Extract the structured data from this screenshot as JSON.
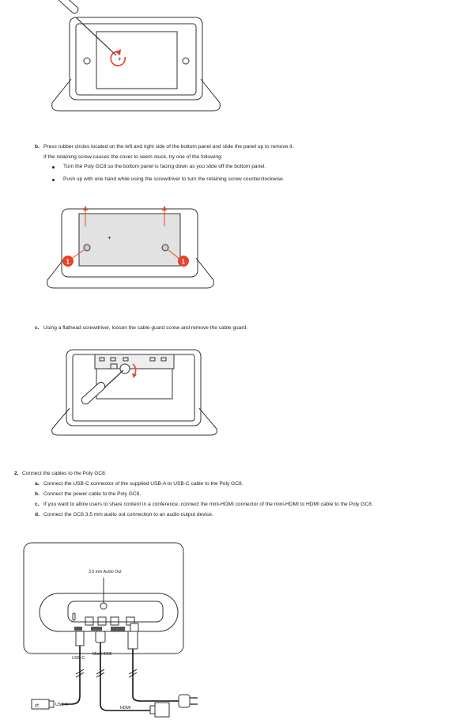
{
  "step_b": {
    "label": "b.",
    "text": "Press rubber circles located on the left and right side of the bottom panel and slide the panel up to remove it.",
    "note": "If the retaining screw causes the cover to seem stuck, try one of the following:",
    "bullets": [
      "Turn the Poly GC8 so the bottom panel is facing down as you slide off the bottom panel.",
      "Push up with one hand while using the screwdriver to turn the retaining screw counterclockwise."
    ]
  },
  "callouts": [
    "1",
    "1"
  ],
  "step_c": {
    "label": "c.",
    "text": "Using a flathead screwdriver, loosen the cable guard screw and remove the cable guard."
  },
  "step_2": {
    "label": "2.",
    "text": "Connect the cables to the Poly GC8.",
    "substeps": [
      {
        "label": "a.",
        "text": "Connect the USB-C connector of the supplied USB-A to USB-C cable to the Poly GC8."
      },
      {
        "label": "b.",
        "text": "Connect the power cable to the Poly GC8."
      },
      {
        "label": "c.",
        "text": "If you want to allow users to share content in a conference, connect the mini-HDMI connector of the mini-HDMI to HDMI cable to the Poly GC8."
      },
      {
        "label": "d.",
        "text": "Connect the GC8 3.5 mm audio out connection to an audio output device."
      }
    ]
  },
  "figure4": {
    "audio_label": "3.5 mm Audio Out",
    "usbc_label": "USB-C",
    "minihdmi_label": "Mini-HDMI",
    "usba_label": "USB-A",
    "hdmi_label": "HDMI"
  },
  "colors": {
    "accent": "#e8432a",
    "line": "#333333",
    "panel": "#e2e2e2"
  }
}
